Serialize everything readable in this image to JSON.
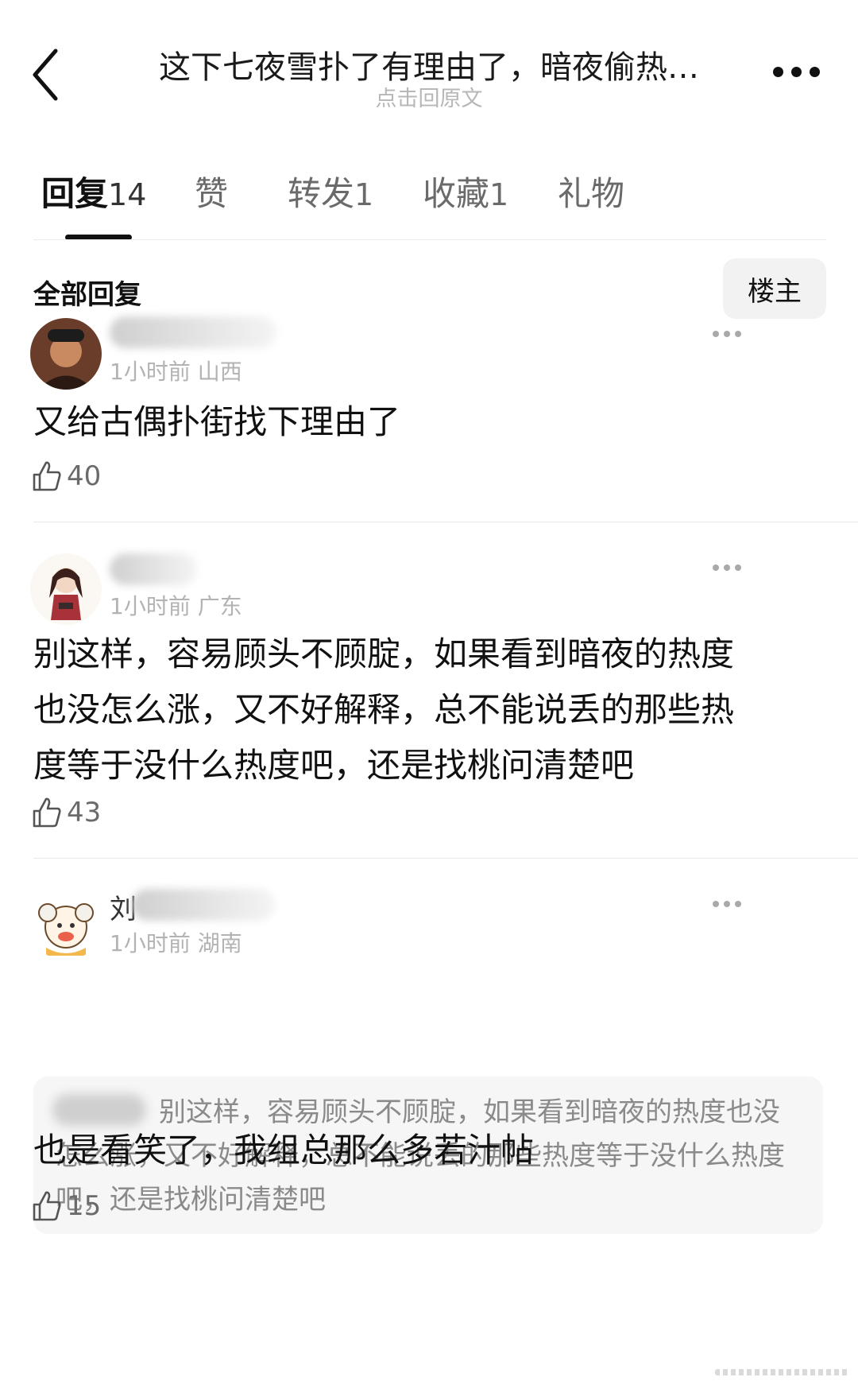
{
  "header": {
    "title": "这下七夜雪扑了有理由了，暗夜偷热…",
    "subtitle": "点击回原文"
  },
  "tabs": [
    {
      "label": "回复",
      "count": "14"
    },
    {
      "label": "赞",
      "count": ""
    },
    {
      "label": "转发",
      "count": "1"
    },
    {
      "label": "收藏",
      "count": "1"
    },
    {
      "label": "礼物",
      "count": ""
    }
  ],
  "section": {
    "title": "全部回复",
    "filter_label": "楼主"
  },
  "comments": [
    {
      "time": "1小时前",
      "location": "山西",
      "text": "又给古偶扑街找下理由了",
      "likes": "40"
    },
    {
      "time": "1小时前",
      "location": "广东",
      "text": "别这样，容易顾头不顾腚，如果看到暗夜的热度也没怎么涨，又不好解释，总不能说丢的那些热度等于没什么热度吧，还是找桃问清楚吧",
      "likes": "43"
    },
    {
      "name_visible": "刘",
      "time": "1小时前",
      "location": "湖南",
      "quote": "别这样，容易顾头不顾腚，如果看到暗夜的热度也没怎么涨，又不好解释，总不能说丢的那些热度等于没什么热度吧，还是找桃问清楚吧",
      "text": "也是看笑了，我组总那么多若汁帖",
      "likes": "15"
    }
  ],
  "icons": {
    "back": "chevron-left-icon",
    "more": "more-horizontal-icon",
    "like": "thumbs-up-icon"
  }
}
